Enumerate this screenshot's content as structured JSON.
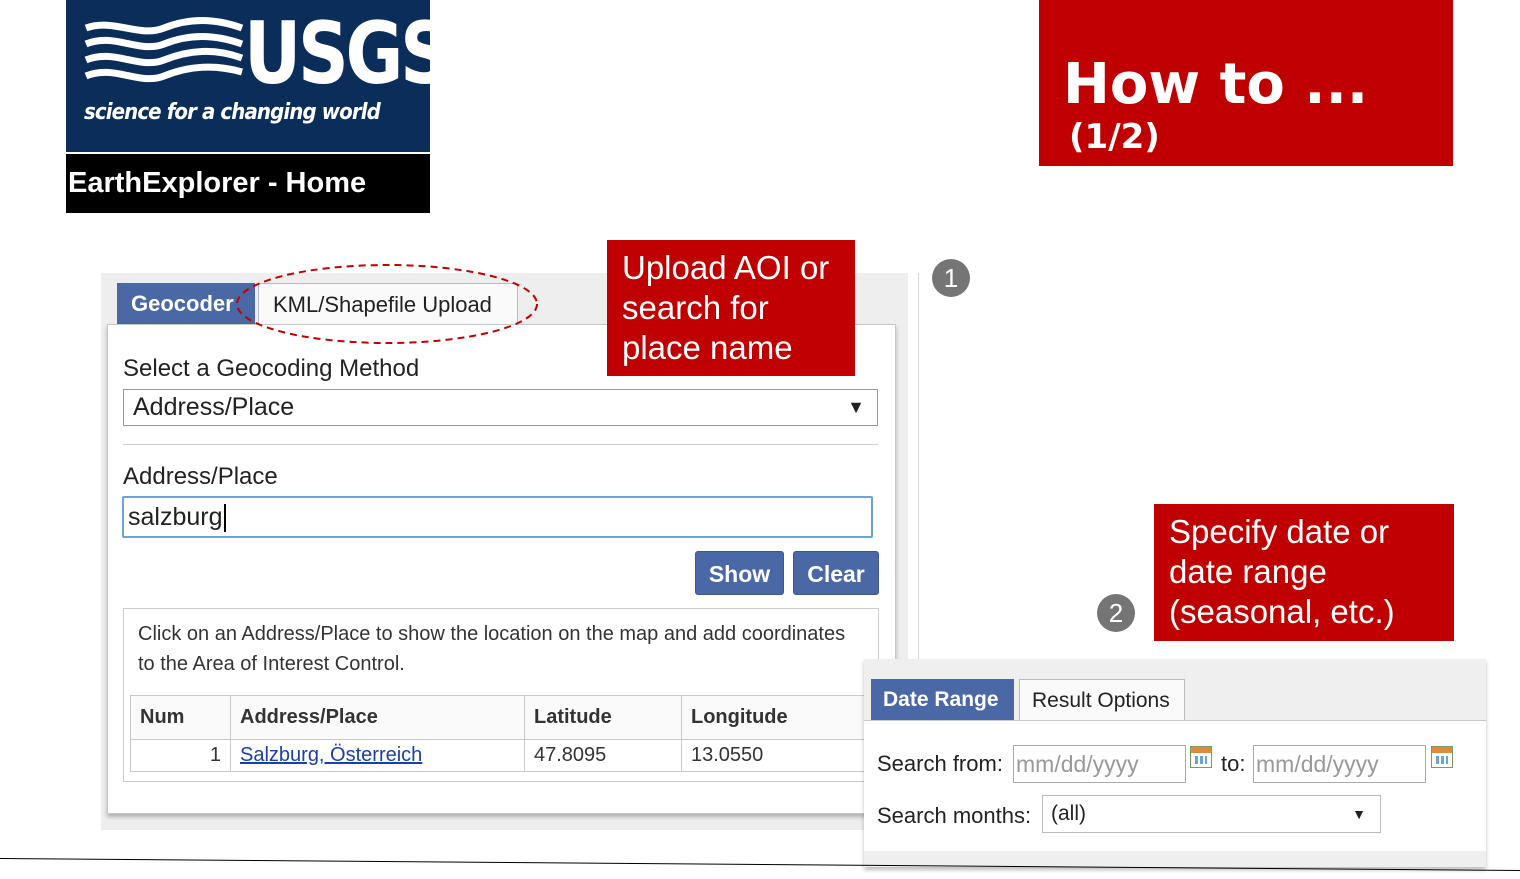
{
  "logo": {
    "wordmark": "USGS",
    "tagline": "science for a changing world"
  },
  "header": {
    "app_name": "EarthExplorer - Home"
  },
  "title": {
    "main": "How to ...",
    "part": "(1/2)"
  },
  "callouts": {
    "one": {
      "number": "1",
      "text_lines": [
        "Upload AOI or",
        "search for",
        "place name"
      ]
    },
    "two": {
      "number": "2",
      "text_lines": [
        "Specify date or",
        "date range",
        "(seasonal, etc.)"
      ]
    }
  },
  "geocoder": {
    "tabs": [
      "Geocoder",
      "KML/Shapefile Upload"
    ],
    "method_label": "Select a Geocoding Method",
    "method_value": "Address/Place",
    "address_label": "Address/Place",
    "address_value": "salzburg",
    "show_button": "Show",
    "clear_button": "Clear",
    "results_message": "Click on an Address/Place to show the location on the map and add coordinates to the Area of Interest Control.",
    "table": {
      "headers": [
        "Num",
        "Address/Place",
        "Latitude",
        "Longitude"
      ],
      "rows": [
        {
          "num": "1",
          "place": "Salzburg, Österreich",
          "lat": "47.8095",
          "lon": "13.0550"
        }
      ]
    }
  },
  "date_range": {
    "tabs": [
      "Date Range",
      "Result Options"
    ],
    "search_from_label": "Search from:",
    "from_placeholder": "mm/dd/yyyy",
    "to_label": "to:",
    "to_placeholder": "mm/dd/yyyy",
    "months_label": "Search months:",
    "months_value": "(all)"
  },
  "colors": {
    "accent_red": "#c00000",
    "tab_blue": "#4a68a5",
    "usgs_navy": "#0b2d5a"
  },
  "icons": [
    "usgs-wave-icon",
    "calendar-icon",
    "dropdown-arrow-icon"
  ]
}
